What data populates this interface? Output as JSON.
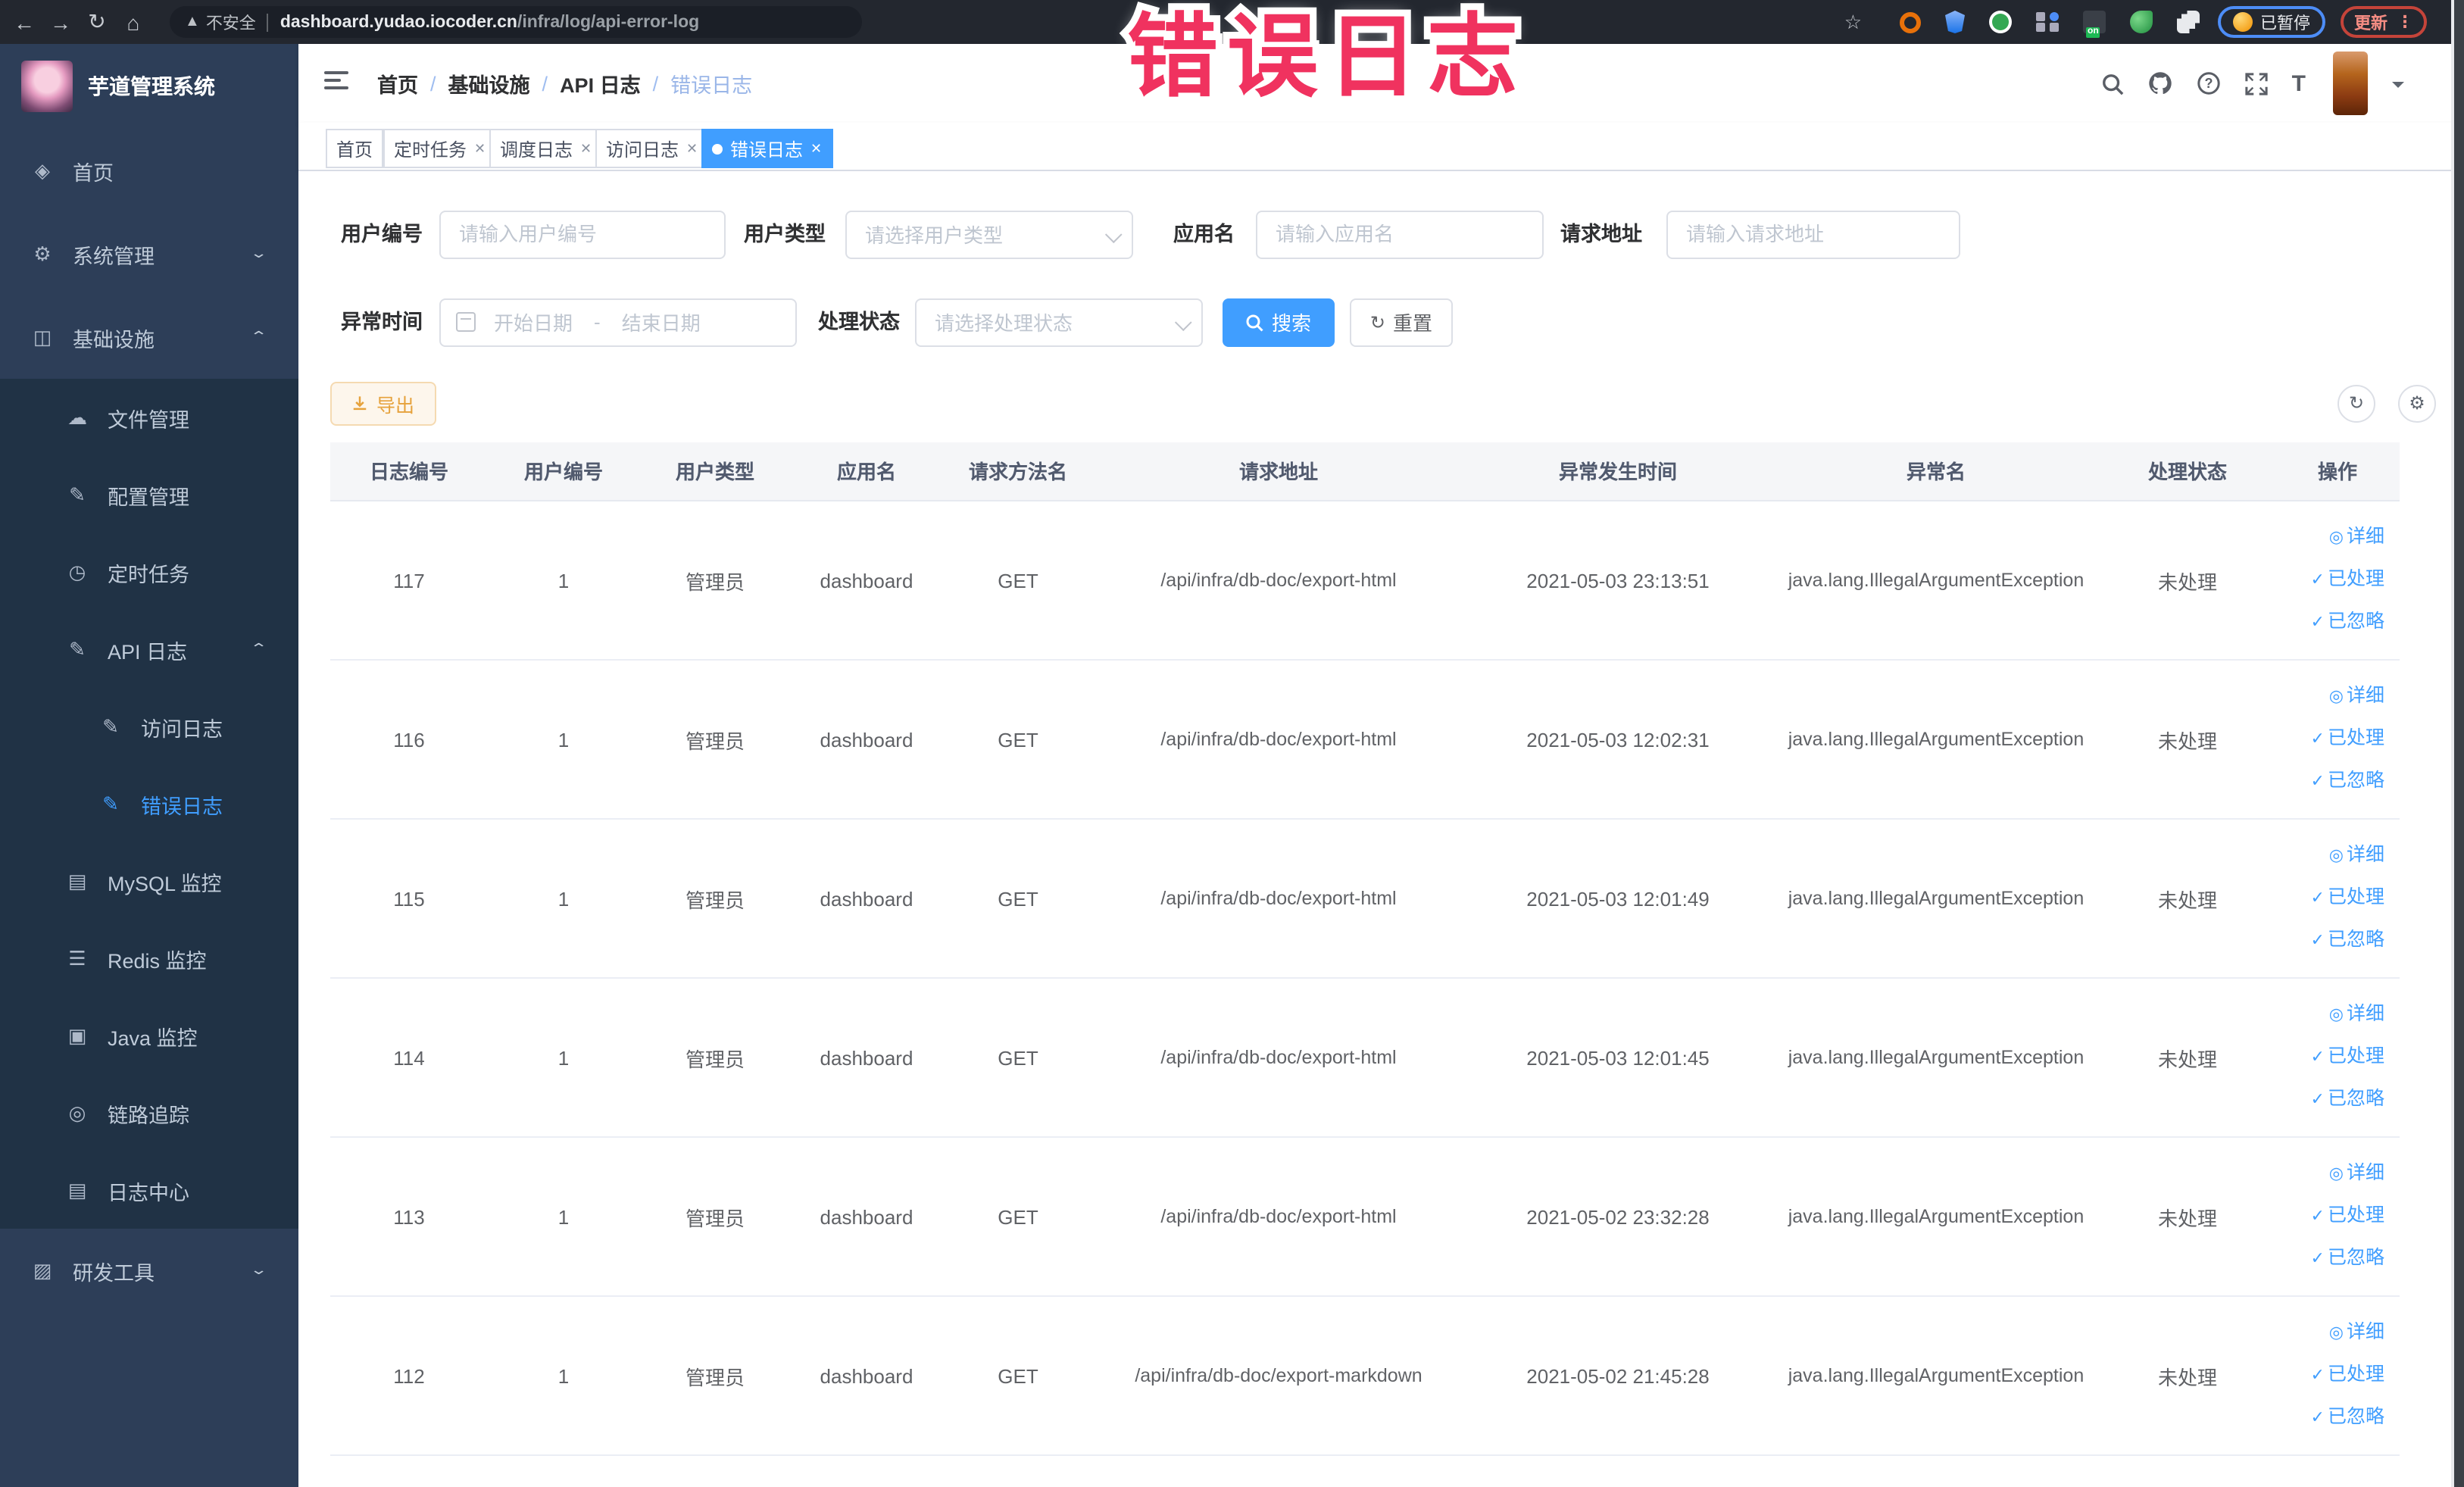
{
  "browser": {
    "security_label": "不安全",
    "url_host": "dashboard.yudao.iocoder.cn",
    "url_path": "/infra/log/api-error-log",
    "paused_badge": "已暂停",
    "update_button": "更新"
  },
  "overlay": {
    "title": "错误日志",
    "color": "#f0325f"
  },
  "sidebar": {
    "title": "芋道管理系统",
    "items": [
      {
        "label": "首页"
      },
      {
        "label": "系统管理"
      },
      {
        "label": "基础设施"
      },
      {
        "label": "文件管理"
      },
      {
        "label": "配置管理"
      },
      {
        "label": "定时任务"
      },
      {
        "label": "API 日志"
      },
      {
        "label": "访问日志"
      },
      {
        "label": "错误日志"
      },
      {
        "label": "MySQL 监控"
      },
      {
        "label": "Redis 监控"
      },
      {
        "label": "Java 监控"
      },
      {
        "label": "链路追踪"
      },
      {
        "label": "日志中心"
      },
      {
        "label": "研发工具"
      }
    ]
  },
  "navbar": {
    "breadcrumb": [
      "首页",
      "基础设施",
      "API 日志",
      "错误日志"
    ]
  },
  "tabs": [
    {
      "label": "首页"
    },
    {
      "label": "定时任务"
    },
    {
      "label": "调度日志"
    },
    {
      "label": "访问日志"
    },
    {
      "label": "错误日志"
    }
  ],
  "filters": {
    "labels": {
      "user_id": "用户编号",
      "user_type": "用户类型",
      "app_name": "应用名",
      "request_url": "请求地址",
      "exception_time": "异常时间",
      "process_status": "处理状态"
    },
    "placeholders": {
      "user_id": "请输入用户编号",
      "user_type": "请选择用户类型",
      "app_name": "请输入应用名",
      "request_url": "请输入请求地址",
      "date_start": "开始日期",
      "date_end": "结束日期",
      "process_status": "请选择处理状态"
    },
    "range_separator": "-",
    "search_label": "搜索",
    "reset_label": "重置"
  },
  "toolbar": {
    "export_label": "导出"
  },
  "table": {
    "columns": [
      "日志编号",
      "用户编号",
      "用户类型",
      "应用名",
      "请求方法名",
      "请求地址",
      "异常发生时间",
      "异常名",
      "处理状态",
      "操作"
    ],
    "actions": [
      "详细",
      "已处理",
      "已忽略"
    ],
    "rows": [
      {
        "id": "117",
        "user_id": "1",
        "user_type": "管理员",
        "app": "dashboard",
        "method": "GET",
        "url": "/api/infra/db-doc/export-html",
        "time": "2021-05-03 23:13:51",
        "exception": "java.lang.IllegalArgumentException",
        "status": "未处理"
      },
      {
        "id": "116",
        "user_id": "1",
        "user_type": "管理员",
        "app": "dashboard",
        "method": "GET",
        "url": "/api/infra/db-doc/export-html",
        "time": "2021-05-03 12:02:31",
        "exception": "java.lang.IllegalArgumentException",
        "status": "未处理"
      },
      {
        "id": "115",
        "user_id": "1",
        "user_type": "管理员",
        "app": "dashboard",
        "method": "GET",
        "url": "/api/infra/db-doc/export-html",
        "time": "2021-05-03 12:01:49",
        "exception": "java.lang.IllegalArgumentException",
        "status": "未处理"
      },
      {
        "id": "114",
        "user_id": "1",
        "user_type": "管理员",
        "app": "dashboard",
        "method": "GET",
        "url": "/api/infra/db-doc/export-html",
        "time": "2021-05-03 12:01:45",
        "exception": "java.lang.IllegalArgumentException",
        "status": "未处理"
      },
      {
        "id": "113",
        "user_id": "1",
        "user_type": "管理员",
        "app": "dashboard",
        "method": "GET",
        "url": "/api/infra/db-doc/export-html",
        "time": "2021-05-02 23:32:28",
        "exception": "java.lang.IllegalArgumentException",
        "status": "未处理"
      },
      {
        "id": "112",
        "user_id": "1",
        "user_type": "管理员",
        "app": "dashboard",
        "method": "GET",
        "url": "/api/infra/db-doc/export-markdown",
        "time": "2021-05-02 21:45:28",
        "exception": "java.lang.IllegalArgumentException",
        "status": "未处理"
      }
    ]
  }
}
